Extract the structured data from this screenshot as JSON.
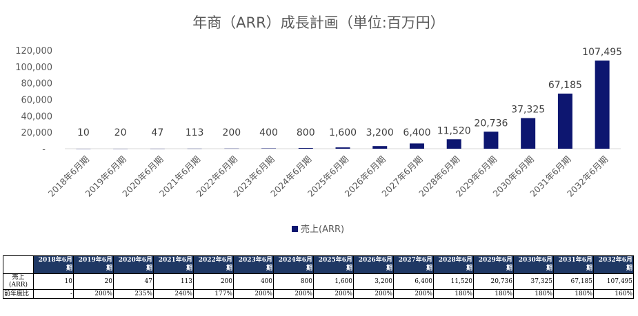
{
  "chart_data": {
    "type": "bar",
    "title": "年商（ARR）成長計画（単位:百万円）",
    "categories": [
      "2018年6月期",
      "2019年6月期",
      "2020年6月期",
      "2021年6月期",
      "2022年6月期",
      "2023年6月期",
      "2024年6月期",
      "2025年6月期",
      "2026年6月期",
      "2027年6月期",
      "2028年6月期",
      "2029年6月期",
      "2030年6月期",
      "2031年6月期",
      "2032年6月期"
    ],
    "series": [
      {
        "name": "売上(ARR)",
        "values": [
          10,
          20,
          47,
          113,
          200,
          400,
          800,
          1600,
          3200,
          6400,
          11520,
          20736,
          37325,
          67185,
          107495
        ]
      }
    ],
    "data_labels": [
      "10",
      "20",
      "47",
      "113",
      "200",
      "400",
      "800",
      "1,600",
      "3,200",
      "6,400",
      "11,520",
      "20,736",
      "37,325",
      "67,185",
      "107,495"
    ],
    "ylim": [
      0,
      120000
    ],
    "yticks": [
      0,
      20000,
      40000,
      60000,
      80000,
      100000,
      120000
    ],
    "ytick_labels": [
      "-",
      "20,000",
      "40,000",
      "60,000",
      "80,000",
      "100,000",
      "120,000"
    ],
    "grid": false,
    "legend_position": "bottom",
    "bar_color": "#0d1670"
  },
  "table": {
    "headers": [
      "2018年6月期",
      "2019年6月期",
      "2020年6月期",
      "2021年6月期",
      "2022年6月期",
      "2023年6月期",
      "2024年6月期",
      "2025年6月期",
      "2026年6月期",
      "2027年6月期",
      "2028年6月期",
      "2029年6月期",
      "2030年6月期",
      "2031年6月期",
      "2032年6月期"
    ],
    "rows": [
      {
        "label": "売上\n(ARR)",
        "cells": [
          "10",
          "20",
          "47",
          "113",
          "200",
          "400",
          "800",
          "1,600",
          "3,200",
          "6,400",
          "11,520",
          "20,736",
          "37,325",
          "67,185",
          "107,495"
        ]
      },
      {
        "label": "前年度比",
        "cells": [
          "-",
          "200%",
          "235%",
          "240%",
          "177%",
          "200%",
          "200%",
          "200%",
          "200%",
          "200%",
          "180%",
          "180%",
          "180%",
          "180%",
          "160%"
        ]
      }
    ]
  }
}
